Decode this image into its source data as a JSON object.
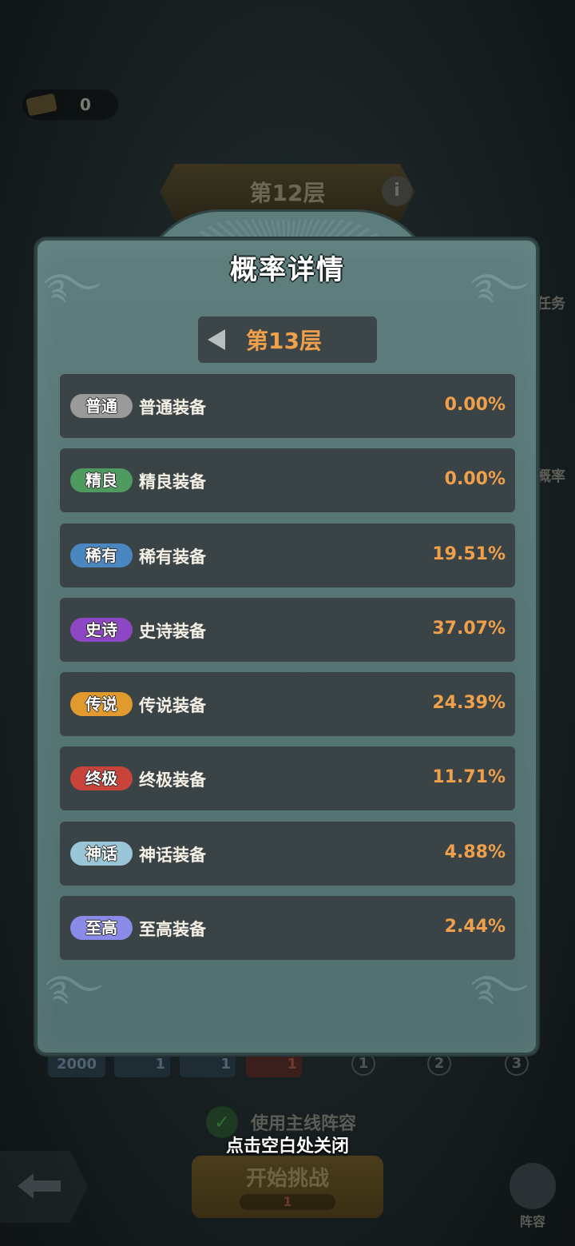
{
  "background": {
    "currency_value": "0",
    "floor_banner": "第12层",
    "info_icon": "info-icon",
    "side_labels": [
      "任务",
      "概率"
    ],
    "bottom_values": [
      "2000",
      "1",
      "1",
      "1"
    ],
    "steps": [
      "1",
      "2",
      "3"
    ],
    "use_main_lineup": "使用主线阵容",
    "start_button": "开始挑战",
    "start_cost": "1",
    "team_label": "阵容"
  },
  "modal": {
    "title": "概率详情",
    "floor_label": "第13层",
    "prev_icon": "triangle-left-icon",
    "rows": [
      {
        "badge": "普通",
        "name": "普通装备",
        "value": "0.00%",
        "color": "#9a9a9a"
      },
      {
        "badge": "精良",
        "name": "精良装备",
        "value": "0.00%",
        "color": "#4f9a5e"
      },
      {
        "badge": "稀有",
        "name": "稀有装备",
        "value": "19.51%",
        "color": "#4a86c0"
      },
      {
        "badge": "史诗",
        "name": "史诗装备",
        "value": "37.07%",
        "color": "#8e47c4"
      },
      {
        "badge": "传说",
        "name": "传说装备",
        "value": "24.39%",
        "color": "#e09a2e"
      },
      {
        "badge": "终极",
        "name": "终极装备",
        "value": "11.71%",
        "color": "#c8443a"
      },
      {
        "badge": "神话",
        "name": "神话装备",
        "value": "4.88%",
        "color": "#9ac6d8"
      },
      {
        "badge": "至高",
        "name": "至高装备",
        "value": "2.44%",
        "color": "#8a8ae8"
      }
    ]
  },
  "close_hint": "点击空白处关闭",
  "colors": {
    "accent": "#f0a04a",
    "row_bg": "#3a4346",
    "panel": "#577676"
  }
}
